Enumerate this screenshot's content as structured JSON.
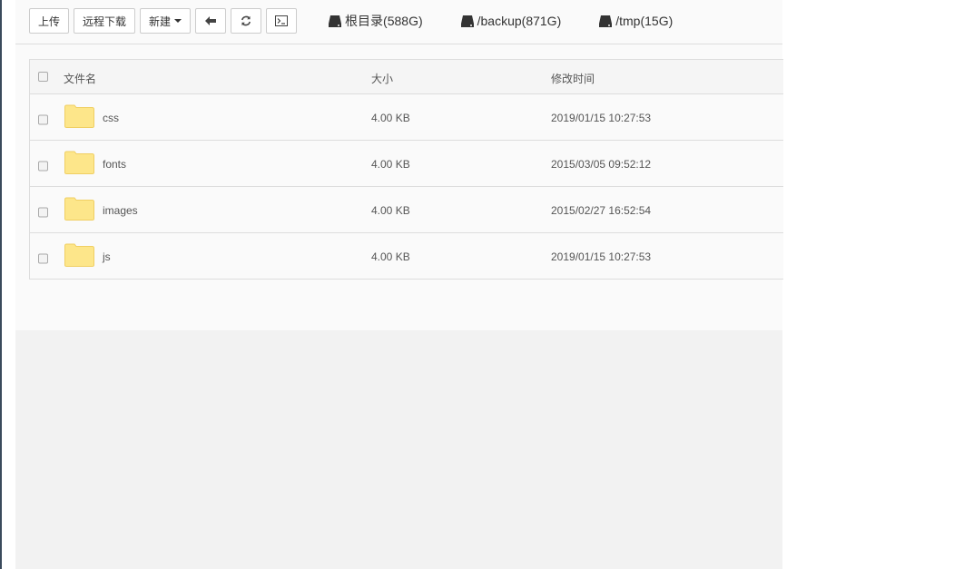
{
  "toolbar": {
    "upload_label": "上传",
    "remote_download_label": "远程下载",
    "new_label": "新建",
    "back_icon": "arrow-left-icon",
    "refresh_icon": "refresh-icon",
    "terminal_icon": "terminal-icon"
  },
  "disks": [
    {
      "label": "根目录(588G)"
    },
    {
      "label": "/backup(871G)"
    },
    {
      "label": "/tmp(15G)"
    }
  ],
  "table": {
    "headers": {
      "name": "文件名",
      "size": "大小",
      "modified": "修改时间"
    },
    "rows": [
      {
        "name": "css",
        "size": "4.00 KB",
        "modified": "2019/01/15 10:27:53"
      },
      {
        "name": "fonts",
        "size": "4.00 KB",
        "modified": "2015/03/05 09:52:12"
      },
      {
        "name": "images",
        "size": "4.00 KB",
        "modified": "2015/02/27 16:52:54"
      },
      {
        "name": "js",
        "size": "4.00 KB",
        "modified": "2019/01/15 10:27:53"
      }
    ]
  },
  "colors": {
    "folder": "#fde68a",
    "folder_border": "#f0cf63",
    "sidebar_edge": "#3a4a5c"
  }
}
